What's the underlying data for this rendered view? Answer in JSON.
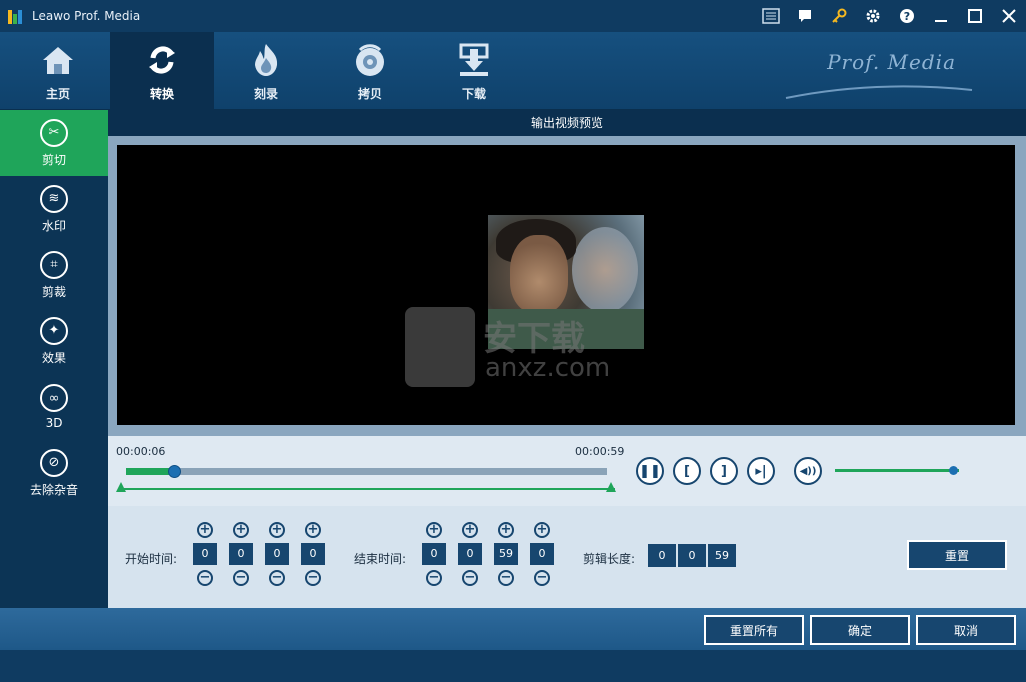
{
  "app": {
    "title": "Leawo Prof. Media",
    "brand": "Prof. Media"
  },
  "top_nav": [
    {
      "label": "主页",
      "icon": "home-icon"
    },
    {
      "label": "转换",
      "icon": "convert-icon",
      "active": true
    },
    {
      "label": "刻录",
      "icon": "burn-icon"
    },
    {
      "label": "拷贝",
      "icon": "copy-disc-icon"
    },
    {
      "label": "下载",
      "icon": "download-icon"
    }
  ],
  "sidebar": [
    {
      "label": "剪切",
      "icon": "scissors-icon",
      "glyph": "✂",
      "active": true
    },
    {
      "label": "水印",
      "icon": "watermark-icon",
      "glyph": "≋"
    },
    {
      "label": "剪裁",
      "icon": "crop-icon",
      "glyph": "⌗"
    },
    {
      "label": "效果",
      "icon": "effect-icon",
      "glyph": "✦"
    },
    {
      "label": "3D",
      "icon": "3d-glasses-icon",
      "glyph": "∞"
    },
    {
      "label": "去除杂音",
      "icon": "noise-removal-icon",
      "glyph": "⊘"
    }
  ],
  "preview": {
    "header": "输出视频预览",
    "watermark_text": "安下载",
    "watermark_url": "anxz.com"
  },
  "timeline": {
    "start_time": "00:00:06",
    "end_time": "00:00:59",
    "position_fraction": 0.1,
    "volume_fraction": 0.95
  },
  "controls": {
    "pause": "❚❚",
    "mark_in": "[",
    "mark_out": "]",
    "next": "▸|",
    "volume": "◀))"
  },
  "edit": {
    "start_label": "开始时间:",
    "start_values": [
      "0",
      "0",
      "0",
      "0"
    ],
    "end_label": "结束时间:",
    "end_values": [
      "0",
      "0",
      "59",
      "0"
    ],
    "duration_label": "剪辑长度:",
    "duration_values": [
      "0",
      "0",
      "59"
    ],
    "reset_label": "重置",
    "plus": "+",
    "minus": "−"
  },
  "footer": {
    "reset_all": "重置所有",
    "ok": "确定",
    "cancel": "取消"
  },
  "colors": {
    "accent_green": "#1fa55a",
    "dark_blue": "#0f3b61",
    "button_blue": "#17466f"
  }
}
